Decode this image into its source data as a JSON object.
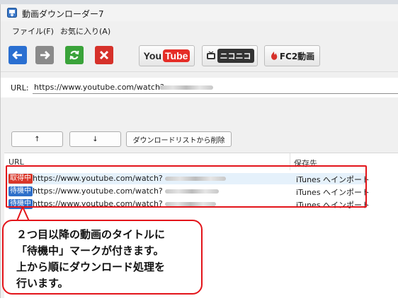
{
  "window": {
    "title": "動画ダウンローダー7"
  },
  "menu": [
    {
      "label": "ファイル(F)"
    },
    {
      "label": "お気に入り(A)"
    }
  ],
  "toolbar": {
    "youtube": {
      "you": "You",
      "tube": "Tube"
    },
    "niconico": {
      "label": "ニコニコ"
    },
    "fc2": {
      "label": "FC2動画"
    }
  },
  "url_bar": {
    "label": "URL:",
    "value": "https://www.youtube.com/watch?v"
  },
  "list_buttons": {
    "up": "↑",
    "down": "↓",
    "delete": "ダウンロードリストから削除"
  },
  "list": {
    "columns": [
      "URL",
      "保存先"
    ],
    "rows": [
      {
        "status": "取得中",
        "status_color": "#d9372a",
        "url": "https://www.youtube.com/watch?",
        "dest": "iTunes へインポート",
        "selected": true
      },
      {
        "status": "待機中",
        "status_color": "#2e6fc9",
        "url": "https://www.youtube.com/watch?",
        "dest": "iTunes へインポート",
        "selected": false
      },
      {
        "status": "待機中",
        "status_color": "#2e6fc9",
        "url": "https://www.youtube.com/watch?",
        "dest": "iTunes へインポート",
        "selected": false
      }
    ]
  },
  "callout": {
    "lines": [
      "２つ目以降の動画のタイトルに",
      "「待機中」マークが付きます。",
      "上から順にダウンロード処理を",
      "行います。"
    ]
  },
  "colors": {
    "highlight": "#e3141a",
    "selected_row": "#e5f1fb"
  },
  "icons": [
    "app-icon",
    "back-arrow-icon",
    "forward-arrow-icon",
    "refresh-icon",
    "stop-icon"
  ]
}
